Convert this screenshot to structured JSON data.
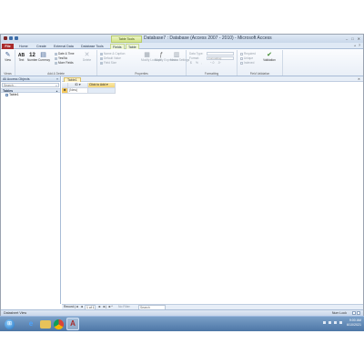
{
  "window": {
    "title": "Database7 : Database (Access 2007 - 2010) - Microsoft Access",
    "context_tab_header": "Table Tools",
    "controls": [
      "–",
      "□",
      "✕"
    ]
  },
  "ribbon": {
    "tabs": [
      "File",
      "Home",
      "Create",
      "External Data",
      "Database Tools",
      "Fields",
      "Table"
    ],
    "active_tab": "Fields",
    "views_group": {
      "label": "Views",
      "view_button": "View"
    },
    "add_delete_group": {
      "label": "Add & Delete",
      "text_button": "Text",
      "text_icon": "AB",
      "number_button": "Number",
      "number_icon": "12",
      "currency_button": "Currency",
      "date_time_button": "Date & Time",
      "yes_no_button": "Yes/No",
      "more_fields_button": "More Fields",
      "delete_button": "Delete"
    },
    "properties_group": {
      "label": "Properties",
      "name_caption": "Name & Caption",
      "default_value": "Default Value",
      "field_size": "Field Size",
      "modify_lookups": "Modify Lookups",
      "modify_expression": "Modify Expression",
      "memo_settings": "Memo Settings"
    },
    "formatting_group": {
      "label": "Formatting",
      "data_type_label": "Data Type:",
      "format_label": "Format:",
      "format_value": "Formatting",
      "symbols": [
        "$",
        "%",
        ","
      ]
    },
    "field_validation_group": {
      "label": "Field Validation",
      "required": "Required",
      "unique": "Unique",
      "indexed": "Indexed",
      "validation_button": "Validation"
    }
  },
  "nav_pane": {
    "header": "All Access Objects",
    "search_placeholder": "Search...",
    "group": "Tables",
    "items": [
      "Table1"
    ]
  },
  "document": {
    "tab_label": "Table1",
    "columns": [
      "ID",
      "Click to Add"
    ],
    "new_row_label": "(New)"
  },
  "record_nav": {
    "label": "Record:",
    "first": "|◄",
    "prev": "◄",
    "position": "1 of 1",
    "next": "►",
    "last": "►|",
    "new": "►*",
    "filter": "No Filter",
    "search": "Search"
  },
  "statusbar": {
    "left": "Datasheet View",
    "right": "Num Lock"
  },
  "taskbar": {
    "time": "9:00 AM",
    "date": "6/10/2021"
  }
}
